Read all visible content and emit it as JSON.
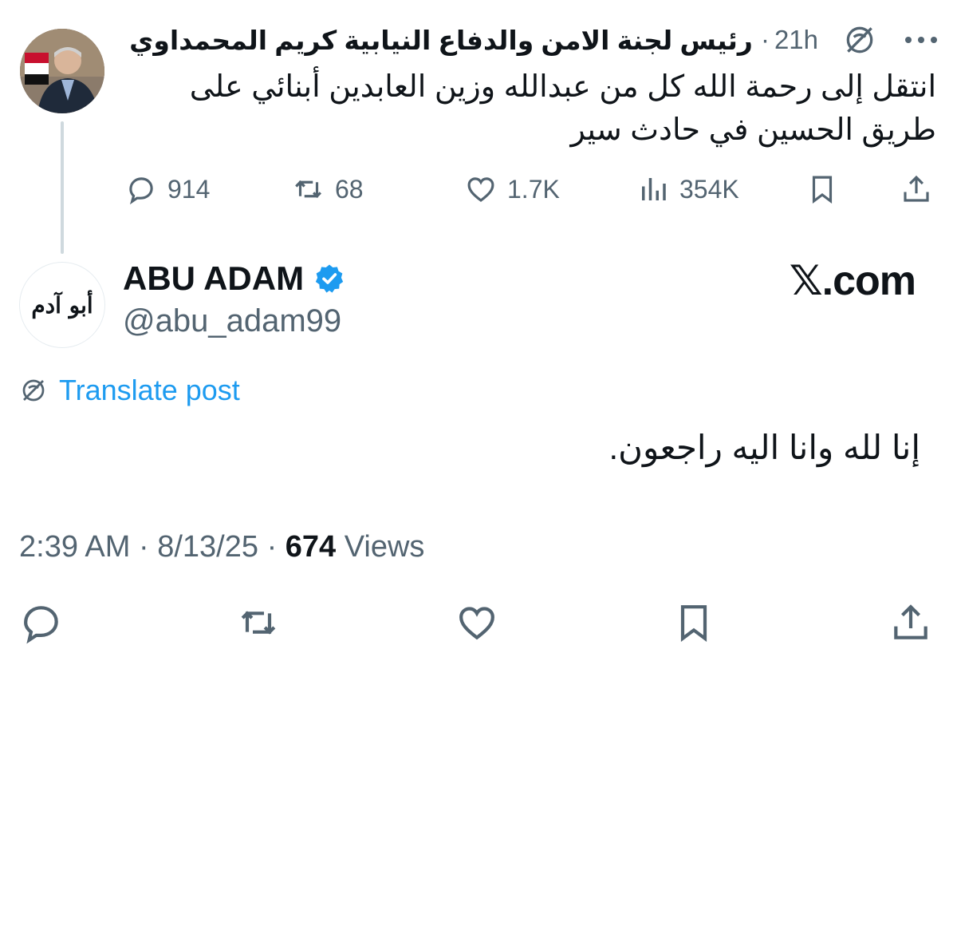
{
  "parent_tweet": {
    "author_name": "رئيس لجنة الامن والدفاع النيابية كريم المحمداوي",
    "separator": "·",
    "time": "21h",
    "more_icon": "more-horizontal-icon",
    "translate_icon": "translate-globe-icon",
    "text": "انتقل إلى رحمة الله كل من عبدالله وزين العابدين أبنائي على طريق الحسين في حادث سير",
    "stats": {
      "replies": "914",
      "reposts": "68",
      "likes": "1.7K",
      "views": "354K"
    }
  },
  "main_tweet": {
    "author_name": "ABU ADAM",
    "verified_color": "#1d9bf0",
    "handle": "@abu_adam99",
    "avatar_text": "أبو آدم",
    "site_label": "𝕏.com",
    "translate_label": "Translate post",
    "text": "إنا لله وانا اليه راجعون.",
    "time": "2:39 AM",
    "date": "8/13/25",
    "separator": "·",
    "views_count": "674",
    "views_label": "Views"
  },
  "colors": {
    "accent": "#1d9bf0",
    "secondary_text": "#536471",
    "primary_text": "#0f1419",
    "thread_line": "#cfd9de"
  }
}
